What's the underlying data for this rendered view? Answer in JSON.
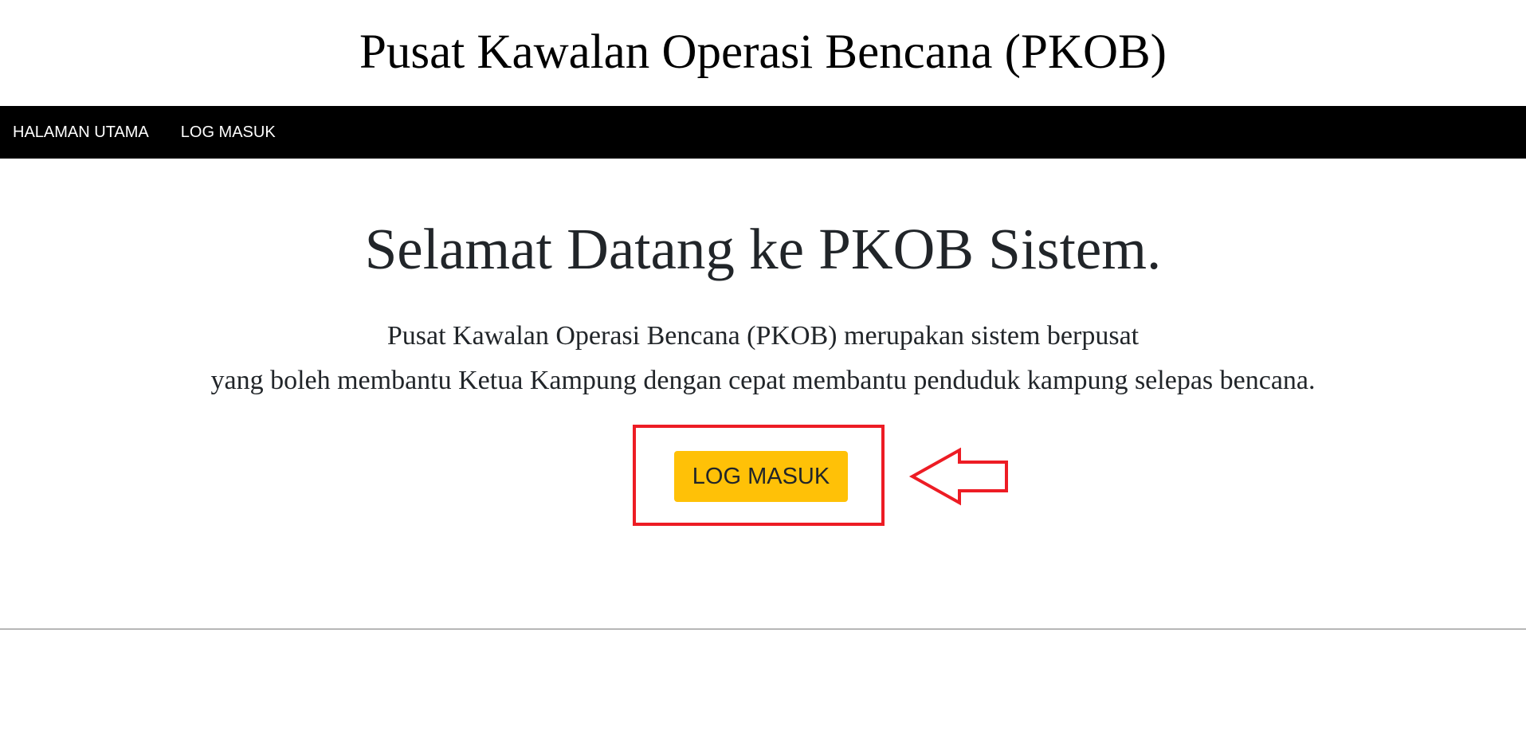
{
  "header": {
    "title": "Pusat Kawalan Operasi Bencana (PKOB)"
  },
  "nav": {
    "items": [
      {
        "label": "HALAMAN UTAMA"
      },
      {
        "label": "LOG MASUK"
      }
    ]
  },
  "main": {
    "heading": "Selamat Datang ke PKOB Sistem.",
    "line1": "Pusat Kawalan Operasi Bencana (PKOB) merupakan sistem berpusat",
    "line2": "yang boleh membantu Ketua Kampung dengan cepat membantu penduduk kampung selepas bencana.",
    "login_label": "LOG MASUK"
  },
  "colors": {
    "button": "#ffc107",
    "annotation": "#ed1c24",
    "nav": "#000000"
  }
}
